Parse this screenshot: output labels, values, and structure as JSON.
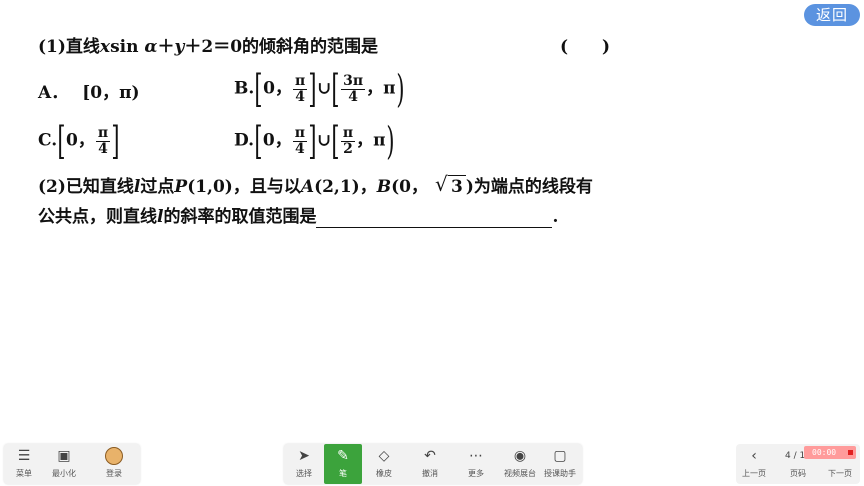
{
  "back_button": "返回",
  "q1": {
    "prefix": "(1)直线",
    "x": "x",
    "sin": "sin ",
    "alpha": "α",
    "plus": "＋",
    "y": "y",
    "rest": "＋2＝0的倾斜角的范围是",
    "paren": "(　　)"
  },
  "options": {
    "a": {
      "label": "A．",
      "text": "[0，π)"
    },
    "b": {
      "label": "B.",
      "zero": "0，",
      "f1n": "π",
      "f1d": "4",
      "union": "∪",
      "f2n": "3π",
      "f2d": "4",
      "tail": "，π"
    },
    "c": {
      "label": "C.",
      "zero": "0，",
      "fn": "π",
      "fd": "4"
    },
    "d": {
      "label": "D.",
      "zero": "0，",
      "f1n": "π",
      "f1d": "4",
      "union": "∪",
      "f2n": "π",
      "f2d": "2",
      "tail": "，π"
    }
  },
  "q2": {
    "l1a": "(2)已知直线",
    "l": "l",
    "l1b": "过点",
    "P": "P",
    "pcoord": "(1,0)，且与以",
    "A": "A",
    "acoord": "(2,1)，",
    "B": "B",
    "bcoord": "(0，",
    "sqrt": "3",
    "l1c": ")为端点的线段有",
    "l2a": "公共点，则直线",
    "l2b": "的斜率的取值范围是",
    "end": "."
  },
  "toolbar": {
    "menu": "菜单",
    "minimize": "最小化",
    "login": "登录",
    "select": "选择",
    "pen": "笔",
    "eraser": "橡皮",
    "undo": "撤消",
    "more": "更多",
    "video": "视频展台",
    "assistant": "授课助手",
    "prev": "上一页",
    "page_label": "页码",
    "page": "4 / 12",
    "next": "下一页",
    "timer": "00:00"
  },
  "colors": {
    "accent": "#3ca33c",
    "back": "#5b93e0"
  }
}
